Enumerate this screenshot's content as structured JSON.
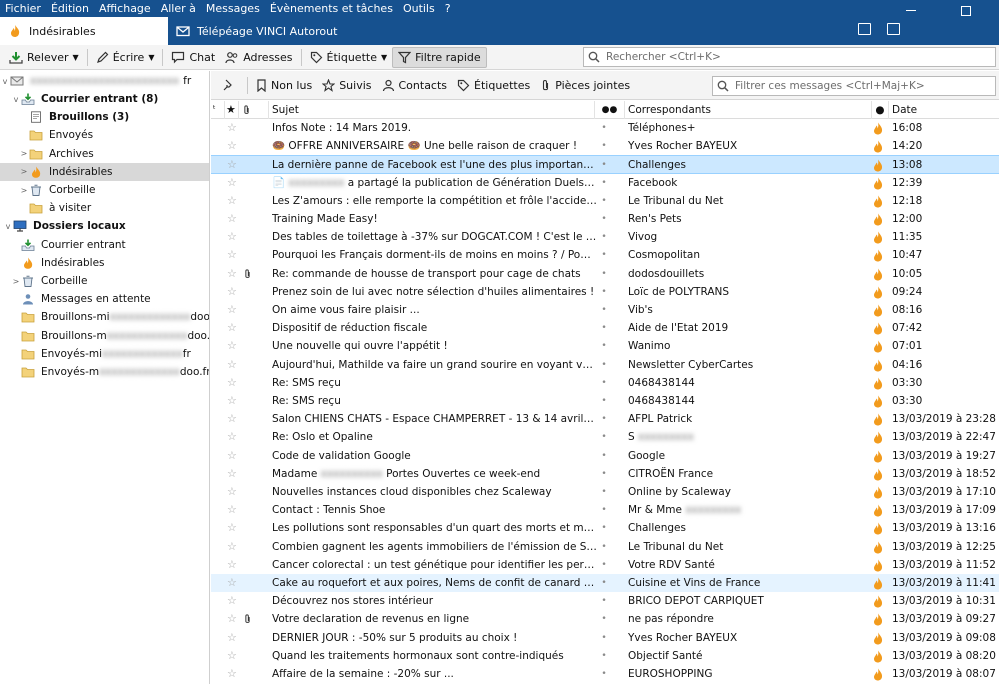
{
  "menu": [
    "Fichier",
    "Édition",
    "Affichage",
    "Aller à",
    "Messages",
    "Évènements et tâches",
    "Outils",
    "?"
  ],
  "tabs": [
    {
      "label": "Indésirables",
      "icon": "flame-icon"
    },
    {
      "label": "Télépéage VINCI Autoroutes",
      "icon": "envelope-icon"
    }
  ],
  "toolbar": {
    "get_mail": "Relever",
    "write": "Écrire",
    "chat": "Chat",
    "address_book": "Adresses",
    "tag": "Étiquette",
    "quick_filter": "Filtre rapide",
    "search_placeholder": "Rechercher <Ctrl+K>"
  },
  "filterbar": {
    "unread": "Non lus",
    "starred": "Suivis",
    "contacts": "Contacts",
    "tags": "Étiquettes",
    "attachments": "Pièces jointes",
    "search_placeholder": "Filtrer ces messages <Ctrl+Maj+K>"
  },
  "columns": {
    "subject": "Sujet",
    "correspondents": "Correspondants",
    "date": "Date"
  },
  "account_label": "fr",
  "folders": [
    {
      "label": "Courrier entrant (8)",
      "bold": true,
      "indent": 1,
      "icon": "inbox-icon",
      "twisty": "v"
    },
    {
      "label": "Brouillons (3)",
      "bold": true,
      "indent": 2,
      "icon": "drafts-icon"
    },
    {
      "label": "Envoyés",
      "indent": 2,
      "icon": "folder-icon"
    },
    {
      "label": "Archives",
      "indent": 2,
      "icon": "folder-icon",
      "twisty": ">"
    },
    {
      "label": "Indésirables",
      "indent": 2,
      "icon": "flame-icon",
      "twisty": ">",
      "selected": true
    },
    {
      "label": "Corbeille",
      "indent": 2,
      "icon": "trash-icon",
      "twisty": ">"
    },
    {
      "label": "à visiter",
      "indent": 2,
      "icon": "folder-icon"
    },
    {
      "label": "Dossiers locaux",
      "bold": true,
      "indent": 0,
      "icon": "computer-icon",
      "twisty": "v"
    },
    {
      "label": "Courrier entrant",
      "indent": 1,
      "icon": "inbox-icon"
    },
    {
      "label": "Indésirables",
      "indent": 1,
      "icon": "flame-icon"
    },
    {
      "label": "Corbeille",
      "indent": 1,
      "icon": "trash-icon",
      "twisty": ">"
    },
    {
      "label": "Messages en attente",
      "indent": 1,
      "icon": "outbox-icon"
    },
    {
      "label": "Brouillons-mi",
      "suffix": "doo.fr",
      "indent": 1,
      "icon": "folder-icon"
    },
    {
      "label": "Brouillons-m",
      "suffix": "doo.fr",
      "indent": 1,
      "icon": "folder-icon"
    },
    {
      "label": "Envoyés-mi",
      "suffix": "fr",
      "indent": 1,
      "icon": "folder-icon"
    },
    {
      "label": "Envoyés-m",
      "suffix": "doo.fr",
      "indent": 1,
      "icon": "folder-icon"
    }
  ],
  "messages": [
    {
      "subject": "Infos Note : 14 Mars 2019.",
      "from": "Téléphones+",
      "date": "16:08"
    },
    {
      "subject": "🍩 OFFRE ANNIVERSAIRE 🍩 Une belle raison de craquer !",
      "from": "Yves Rocher BAYEUX",
      "date": "14:20"
    },
    {
      "subject": "La dernière panne de Facebook est l'une des plus importantes",
      "from": "Challenges",
      "date": "13:08",
      "selected": true
    },
    {
      "subject": "a partagé la publication de Génération Duels Animaux",
      "from": "Facebook",
      "date": "12:39"
    },
    {
      "subject": "Les Z'amours : elle remporte la compétition et frôle l'accident de lingerie",
      "from": "Le Tribunal du Net",
      "date": "12:18"
    },
    {
      "subject": "Training Made Easy!",
      "from": "Ren's Pets",
      "date": "12:00"
    },
    {
      "subject": "Des tables de toilettage à -37% sur DOGCAT.COM ! C'est le moment d'en profiter",
      "from": "Vivog",
      "date": "11:35"
    },
    {
      "subject": "Pourquoi les Français dorment-ils de moins en moins ? / Pourquoi faut-il manger",
      "from": "Cosmopolitan",
      "date": "10:47"
    },
    {
      "subject": "Re: commande de housse de transport pour cage de chats",
      "from": "dodosdouillets",
      "date": "10:05",
      "attachment": true
    },
    {
      "subject": "Prenez soin de lui avec notre sélection d'huiles alimentaires !",
      "from": "Loïc de POLYTRANS",
      "date": "09:24"
    },
    {
      "subject": "On aime vous faire plaisir ...",
      "from": "Vib's",
      "date": "08:16"
    },
    {
      "subject": "Dispositif de réduction fiscale",
      "from": "Aide de l'Etat 2019",
      "date": "07:42"
    },
    {
      "subject": "Une nouvelle qui ouvre l'appétit !",
      "from": "Wanimo",
      "date": "07:01"
    },
    {
      "subject": "Aujourd'hui, Mathilde va faire un grand sourire en voyant votre carte surprise",
      "from": "Newsletter CyberCartes",
      "date": "04:16"
    },
    {
      "subject": "Re: SMS reçu",
      "from": "0468438144",
      "date": "03:30"
    },
    {
      "subject": "Re: SMS reçu",
      "from": "0468438144",
      "date": "03:30"
    },
    {
      "subject": "Salon CHIENS CHATS - Espace CHAMPERRET - 13 & 14 avril 2019",
      "from": "AFPL Patrick",
      "date": "13/03/2019 à 23:28"
    },
    {
      "subject": "Re: Oslo et Opaline",
      "from": "S",
      "date": "13/03/2019 à 22:47"
    },
    {
      "subject": "Code de validation Google",
      "from": "Google",
      "date": "13/03/2019 à 19:27"
    },
    {
      "subject": "Madame",
      "subject_tail": "Portes Ouvertes ce week-end",
      "from": "CITROËN France",
      "date": "13/03/2019 à 18:52"
    },
    {
      "subject": "Nouvelles instances cloud disponibles chez Scaleway",
      "from": "Online by Scaleway",
      "date": "13/03/2019 à 17:10"
    },
    {
      "subject": "Contact : Tennis Shoe",
      "from": "Mr & Mme",
      "date": "13/03/2019 à 17:09"
    },
    {
      "subject": "Les pollutions sont responsables d'un quart des morts et maladies dans le monde",
      "from": "Challenges",
      "date": "13/03/2019 à 13:16"
    },
    {
      "subject": "Combien gagnent les agents immobiliers de l'émission de Stéphane Plaza",
      "from": "Le Tribunal du Net",
      "date": "13/03/2019 à 12:25"
    },
    {
      "subject": "Cancer colorectal : un test génétique pour identifier les personnes les plus à risque",
      "from": "Votre RDV Santé",
      "date": "13/03/2019 à 11:52"
    },
    {
      "subject": "Cake au roquefort et aux poires, Nems de confit de canard au chutney de figues",
      "from": "Cuisine et Vins de France",
      "date": "13/03/2019 à 11:41",
      "hover": true
    },
    {
      "subject": "Découvrez nos stores intérieur",
      "from": "BRICO DEPOT CARPIQUET",
      "date": "13/03/2019 à 10:31"
    },
    {
      "subject": "Votre declaration de revenus en ligne",
      "from": "ne pas répondre",
      "date": "13/03/2019 à 09:27",
      "attachment": true
    },
    {
      "subject": "DERNIER JOUR : -50% sur 5 produits au choix !",
      "from": "Yves Rocher BAYEUX",
      "date": "13/03/2019 à 09:08"
    },
    {
      "subject": "Quand les traitements hormonaux sont contre-indiqués",
      "from": "Objectif Santé",
      "date": "13/03/2019 à 08:20"
    },
    {
      "subject": "Affaire de la semaine : -20% sur ...",
      "from": "EUROSHOPPING",
      "date": "13/03/2019 à 08:07"
    }
  ]
}
